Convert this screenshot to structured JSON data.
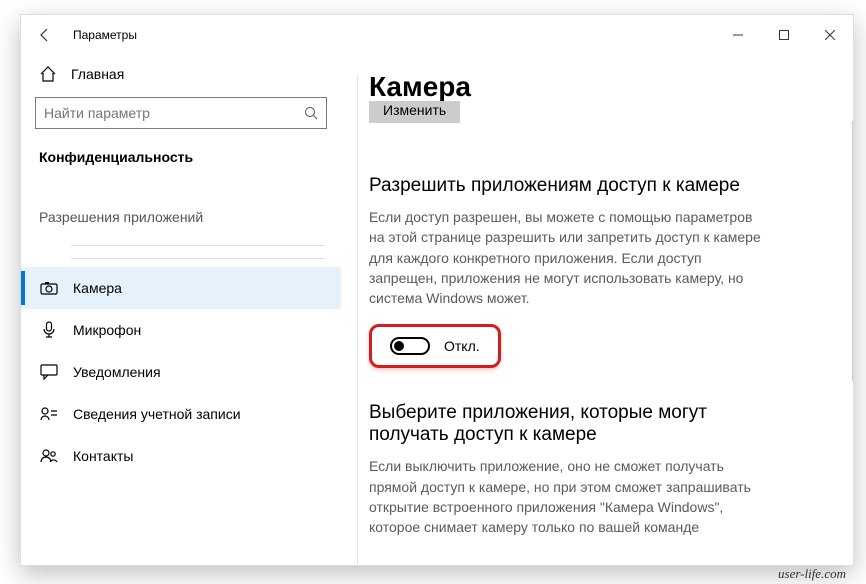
{
  "window": {
    "title": "Параметры"
  },
  "sidebar": {
    "home": "Главная",
    "search_placeholder": "Найти параметр",
    "group": "Конфиденциальность",
    "subgroup": "Разрешения приложений",
    "items": [
      {
        "label": "Камера"
      },
      {
        "label": "Микрофон"
      },
      {
        "label": "Уведомления"
      },
      {
        "label": "Сведения учетной записи"
      },
      {
        "label": "Контакты"
      }
    ]
  },
  "main": {
    "title": "Камера",
    "change_btn": "Изменить",
    "allow_title": "Разрешить приложениям доступ к камере",
    "allow_desc": "Если доступ разрешен, вы можете с помощью параметров на этой странице разрешить или запретить доступ к камере для каждого конкретного приложения. Если доступ запрещен, приложения не могут использовать камеру, но система Windows может.",
    "toggle_label": "Откл.",
    "choose_title": "Выберите приложения, которые могут получать доступ к камере",
    "choose_desc": "Если выключить приложение, оно не сможет получать прямой доступ к камере, но при этом сможет запрашивать открытие встроенного приложения \"Камера Windows\", которое снимает камеру только по вашей команде"
  },
  "watermark": "user-life.com"
}
